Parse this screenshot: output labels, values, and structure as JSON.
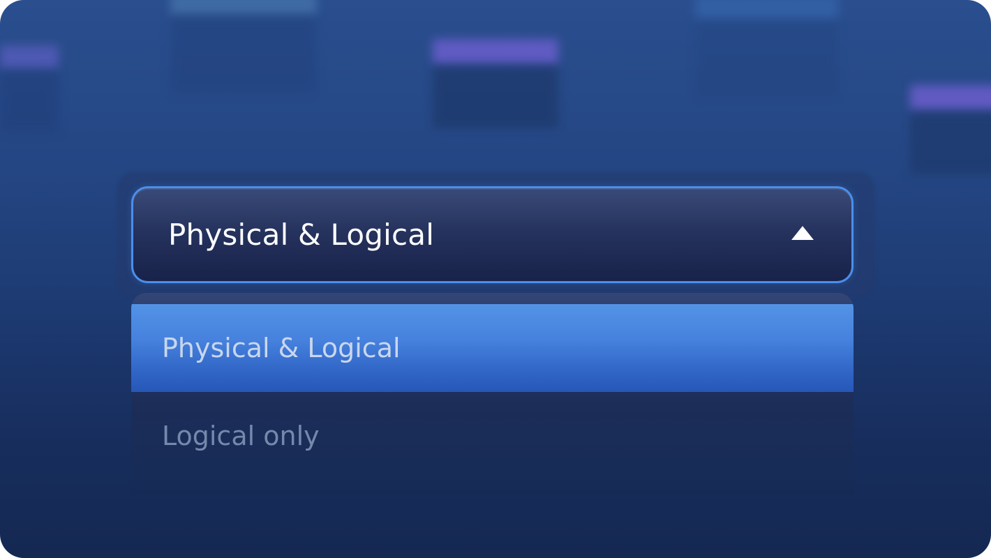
{
  "dropdown": {
    "selected_value": "Physical & Logical",
    "options": [
      {
        "label": "Physical & Logical",
        "selected": true
      },
      {
        "label": "Logical only",
        "selected": false
      }
    ],
    "expanded": true
  },
  "colors": {
    "accent_border": "#4a8fec",
    "highlight": "#4682de",
    "background": "#1d3a72"
  },
  "icons": {
    "chevron": "chevron-up-icon"
  }
}
